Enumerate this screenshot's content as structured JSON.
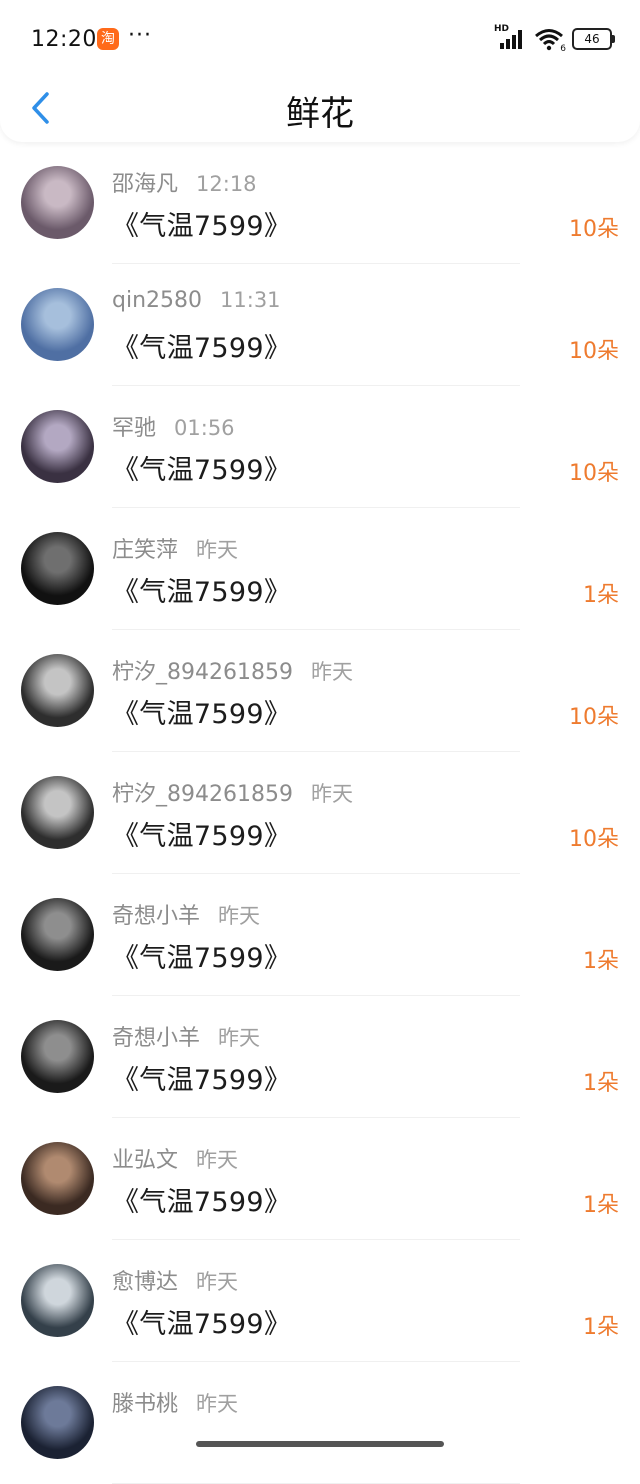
{
  "status_bar": {
    "time": "12:20",
    "app_badge": "淘",
    "more": "···",
    "network": "HD",
    "wifi_sub": "6",
    "battery": "46"
  },
  "header": {
    "title": "鲜花",
    "back_icon": "chevron-left-icon"
  },
  "colors": {
    "accent": "#2f8fe8",
    "count": "#ee7b2f",
    "app_badge": "#ff6a1a"
  },
  "items": [
    {
      "user": "邵海凡",
      "time": "12:18",
      "book": "《气温7599》",
      "count": "10朵",
      "avatar": [
        "#6b5a6a",
        "#c9b9c4"
      ]
    },
    {
      "user": "qin2580",
      "time": "11:31",
      "book": "《气温7599》",
      "count": "10朵",
      "avatar": [
        "#4f6fa3",
        "#a6bfdc"
      ]
    },
    {
      "user": "罕驰",
      "time": "01:56",
      "book": "《气温7599》",
      "count": "10朵",
      "avatar": [
        "#3a3142",
        "#b3a8c2"
      ]
    },
    {
      "user": "庄笑萍",
      "time": "昨天",
      "book": "《气温7599》",
      "count": "1朵",
      "avatar": [
        "#111111",
        "#6f6f6f"
      ]
    },
    {
      "user": "柠汐_894261859",
      "time": "昨天",
      "book": "《气温7599》",
      "count": "10朵",
      "avatar": [
        "#2e2e2e",
        "#c4c4c4"
      ]
    },
    {
      "user": "柠汐_894261859",
      "time": "昨天",
      "book": "《气温7599》",
      "count": "10朵",
      "avatar": [
        "#2e2e2e",
        "#c4c4c4"
      ]
    },
    {
      "user": "奇想小羊",
      "time": "昨天",
      "book": "《气温7599》",
      "count": "1朵",
      "avatar": [
        "#1a1a1a",
        "#8e8e8e"
      ]
    },
    {
      "user": "奇想小羊",
      "time": "昨天",
      "book": "《气温7599》",
      "count": "1朵",
      "avatar": [
        "#1a1a1a",
        "#8e8e8e"
      ]
    },
    {
      "user": "业弘文",
      "time": "昨天",
      "book": "《气温7599》",
      "count": "1朵",
      "avatar": [
        "#3b2a22",
        "#b08a70"
      ]
    },
    {
      "user": "愈博达",
      "time": "昨天",
      "book": "《气温7599》",
      "count": "1朵",
      "avatar": [
        "#34404a",
        "#cfd6dc"
      ]
    },
    {
      "user": "滕书桃",
      "time": "昨天",
      "book": "",
      "count": "",
      "avatar": [
        "#1b2233",
        "#6d7a99"
      ]
    }
  ]
}
